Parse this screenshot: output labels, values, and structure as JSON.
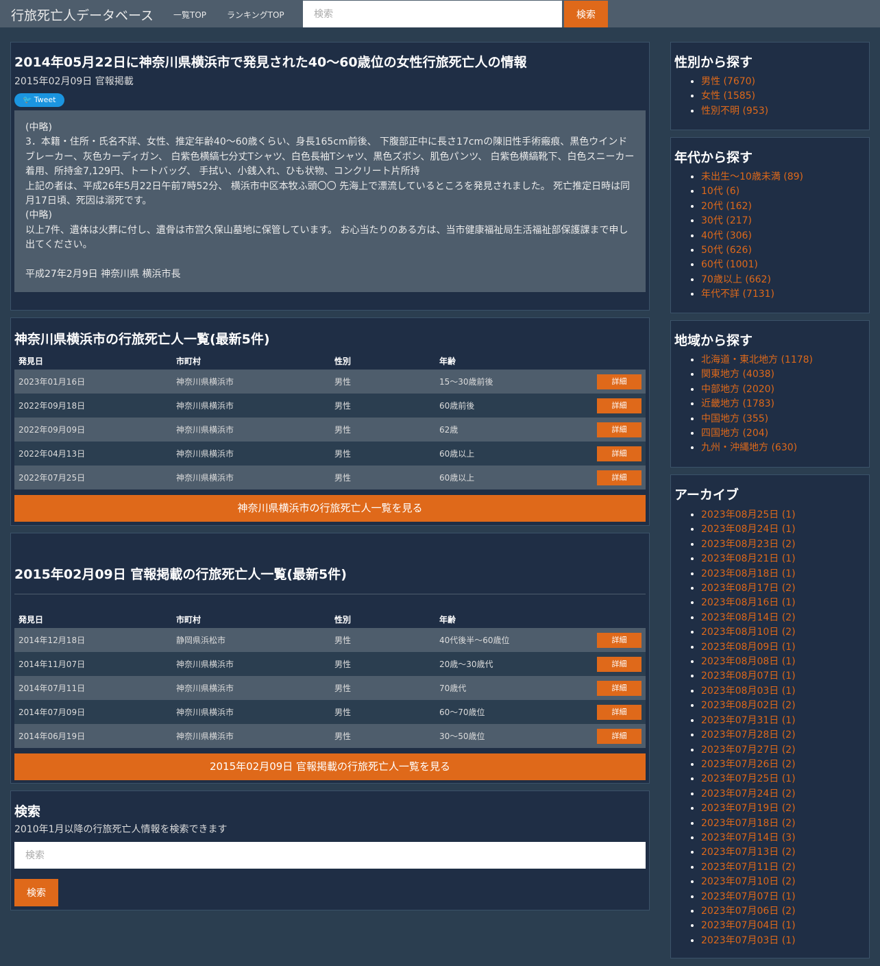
{
  "nav": {
    "brand": "行旅死亡人データベース",
    "links": [
      "一覧TOP",
      "ランキングTOP"
    ],
    "search_placeholder": "検索",
    "search_button": "検索"
  },
  "article": {
    "title": "2014年05月22日に神奈川県横浜市で発見された40～60歳位の女性行旅死亡人の情報",
    "date": "2015年02月09日 官報掲載",
    "tweet_label": "Tweet",
    "body": [
      "(中略)",
      "3．本籍・住所・氏名不詳、女性、推定年齢40～60歳くらい、身長165cm前後、 下腹部正中に長さ17cmの陳旧性手術瘢痕、黒色ウインドブレーカー、灰色カーディガン、 白紫色横縞七分丈Tシャツ、白色長袖Tシャツ、黒色ズボン、肌色パンツ、 白紫色横縞靴下、白色スニーカー着用、所持金7,129円、トートバッグ、 手拭い、小銭入れ、ひも状物、コンクリート片所持",
      "上記の者は、平成26年5月22日午前7時52分、 横浜市中区本牧ふ頭〇〇 先海上で漂流しているところを発見されました。 死亡推定日時は同月17日頃、死因は溺死です。",
      "(中略)",
      "以上7件、遺体は火葬に付し、遺骨は市営久保山墓地に保管しています。 お心当たりのある方は、当市健康福祉局生活福祉部保護課まで申し出てください。",
      "",
      "平成27年2月9日 神奈川県 横浜市長"
    ]
  },
  "city_list": {
    "title": "神奈川県横浜市の行旅死亡人一覧(最新5件)",
    "headers": [
      "発見日",
      "市町村",
      "性別",
      "年齢"
    ],
    "rows": [
      [
        "2023年01月16日",
        "神奈川県横浜市",
        "男性",
        "15～30歳前後"
      ],
      [
        "2022年09月18日",
        "神奈川県横浜市",
        "男性",
        "60歳前後"
      ],
      [
        "2022年09月09日",
        "神奈川県横浜市",
        "男性",
        "62歳"
      ],
      [
        "2022年04月13日",
        "神奈川県横浜市",
        "男性",
        "60歳以上"
      ],
      [
        "2022年07月25日",
        "神奈川県横浜市",
        "男性",
        "60歳以上"
      ]
    ],
    "detail_label": "詳細",
    "more_label": "神奈川県横浜市の行旅死亡人一覧を見る"
  },
  "date_list": {
    "title": "2015年02月09日 官報掲載の行旅死亡人一覧(最新5件)",
    "headers": [
      "発見日",
      "市町村",
      "性別",
      "年齢"
    ],
    "rows": [
      [
        "2014年12月18日",
        "静岡県浜松市",
        "男性",
        "40代後半～60歳位"
      ],
      [
        "2014年11月07日",
        "神奈川県横浜市",
        "男性",
        "20歳～30歳代"
      ],
      [
        "2014年07月11日",
        "神奈川県横浜市",
        "男性",
        "70歳代"
      ],
      [
        "2014年07月09日",
        "神奈川県横浜市",
        "男性",
        "60～70歳位"
      ],
      [
        "2014年06月19日",
        "神奈川県横浜市",
        "男性",
        "30～50歳位"
      ]
    ],
    "detail_label": "詳細",
    "more_label": "2015年02月09日 官報掲載の行旅死亡人一覧を見る"
  },
  "search": {
    "title": "検索",
    "description": "2010年1月以降の行旅死亡人情報を検索できます",
    "placeholder": "検索",
    "button": "検索"
  },
  "sidebar": {
    "gender": {
      "title": "性別から探す",
      "items": [
        "男性 (7670)",
        "女性 (1585)",
        "性別不明 (953)"
      ]
    },
    "age": {
      "title": "年代から探す",
      "items": [
        "未出生～10歳未満 (89)",
        "10代 (6)",
        "20代 (162)",
        "30代 (217)",
        "40代 (306)",
        "50代 (626)",
        "60代 (1001)",
        "70歳以上 (662)",
        "年代不詳 (7131)"
      ]
    },
    "region": {
      "title": "地域から探す",
      "items": [
        "北海道・東北地方 (1178)",
        "関東地方 (4038)",
        "中部地方 (2020)",
        "近畿地方 (1783)",
        "中国地方 (355)",
        "四国地方 (204)",
        "九州・沖縄地方 (630)"
      ]
    },
    "archive": {
      "title": "アーカイブ",
      "items": [
        "2023年08月25日 (1)",
        "2023年08月24日 (1)",
        "2023年08月23日 (2)",
        "2023年08月21日 (1)",
        "2023年08月18日 (1)",
        "2023年08月17日 (2)",
        "2023年08月16日 (1)",
        "2023年08月14日 (2)",
        "2023年08月10日 (2)",
        "2023年08月09日 (1)",
        "2023年08月08日 (1)",
        "2023年08月07日 (1)",
        "2023年08月03日 (1)",
        "2023年08月02日 (2)",
        "2023年07月31日 (1)",
        "2023年07月28日 (2)",
        "2023年07月27日 (2)",
        "2023年07月26日 (2)",
        "2023年07月25日 (1)",
        "2023年07月24日 (2)",
        "2023年07月19日 (2)",
        "2023年07月18日 (2)",
        "2023年07月14日 (3)",
        "2023年07月13日 (2)",
        "2023年07月11日 (2)",
        "2023年07月10日 (2)",
        "2023年07月07日 (1)",
        "2023年07月06日 (2)",
        "2023年07月04日 (1)",
        "2023年07月03日 (1)"
      ]
    }
  }
}
